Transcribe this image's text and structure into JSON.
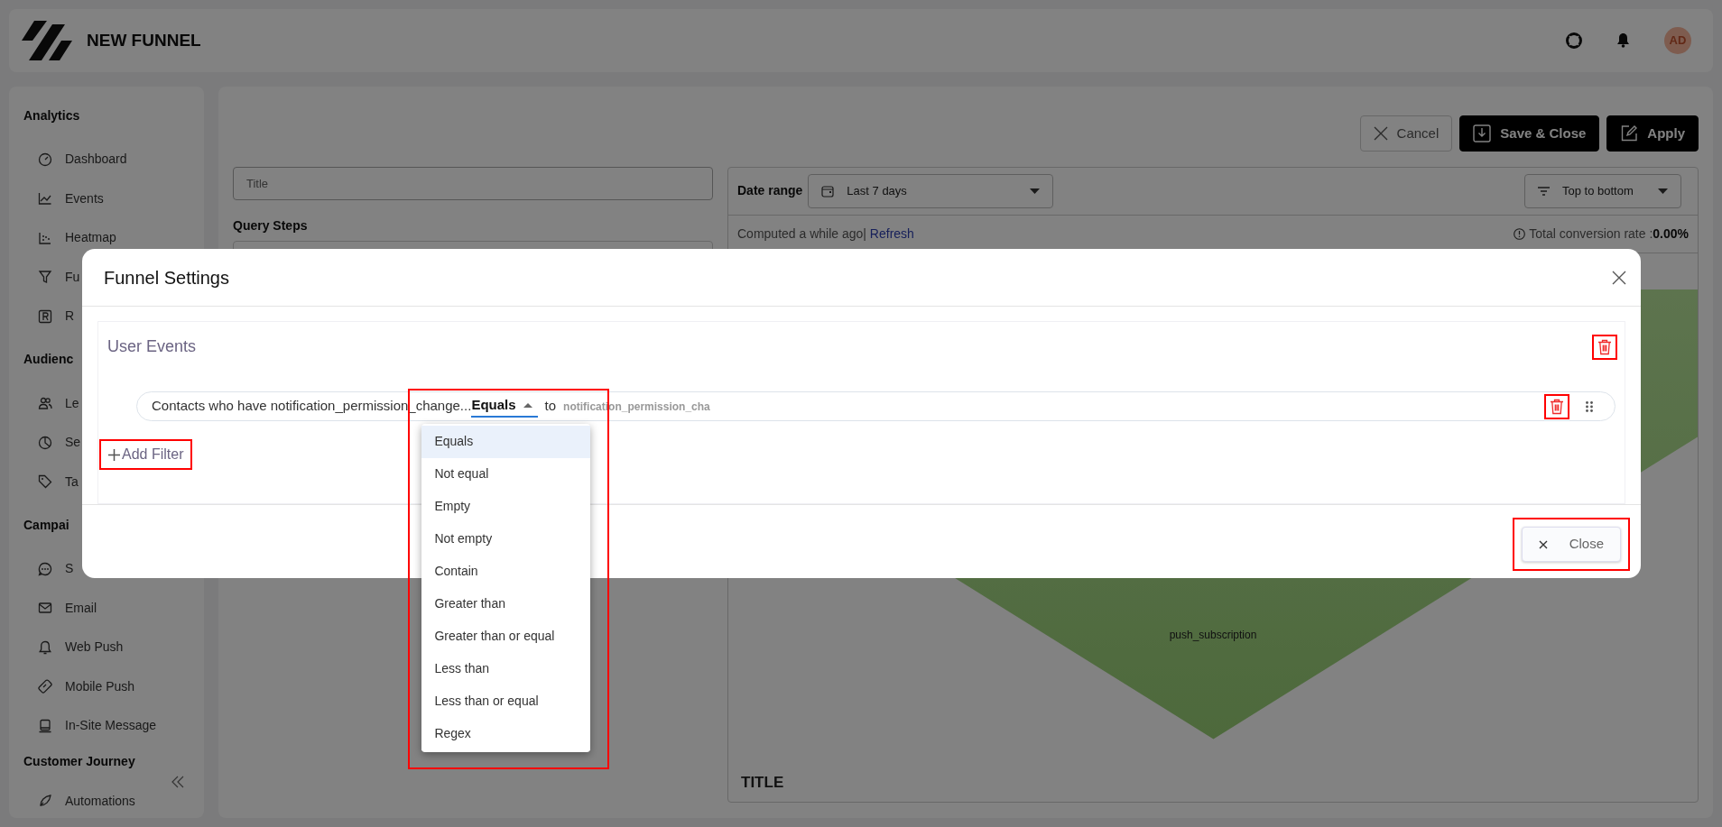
{
  "header": {
    "title": "NEW FUNNEL",
    "avatar": "AD"
  },
  "sidebar": {
    "sections": [
      {
        "title": "Analytics",
        "items": [
          {
            "label": "Dashboard"
          },
          {
            "label": "Events"
          },
          {
            "label": "Heatmap"
          },
          {
            "label": "Fu"
          },
          {
            "label": "R"
          }
        ]
      },
      {
        "title": "Audienc",
        "items": [
          {
            "label": "Le"
          },
          {
            "label": "Se"
          },
          {
            "label": "Ta"
          }
        ]
      },
      {
        "title": "Campai",
        "items": [
          {
            "label": "S"
          },
          {
            "label": "Email"
          },
          {
            "label": "Web Push"
          },
          {
            "label": "Mobile Push"
          },
          {
            "label": "In-Site Message"
          }
        ]
      },
      {
        "title": "Customer Journey",
        "items": [
          {
            "label": "Automations"
          }
        ]
      }
    ]
  },
  "toolbar": [
    {
      "label": "Cancel",
      "kind": "outline"
    },
    {
      "label": "Save & Close",
      "kind": "dark"
    },
    {
      "label": "Apply",
      "kind": "dark"
    }
  ],
  "title_field": {
    "placeholder": "Title"
  },
  "query_steps": {
    "label": "Query Steps"
  },
  "report": {
    "date_range": {
      "label": "Date range",
      "value": "Last 7 days"
    },
    "order": {
      "value": "Top to bottom"
    },
    "computed": "Computed a while ago|",
    "refresh": "Refresh",
    "conversion": {
      "label": "Total conversion rate :",
      "value": "0.00%"
    },
    "funnel_step": "push_subscription",
    "title": "TITLE"
  },
  "modal": {
    "title": "Funnel Settings",
    "section": {
      "title": "User Events",
      "delete_highlighted": true
    },
    "filter": {
      "text": "Contacts who have notification_permission_change...",
      "operator": "Equals",
      "operator_highlighted": true,
      "connector": "to",
      "value_placeholder": "notification_permission_cha",
      "delete_highlighted": true
    },
    "operator_options": [
      {
        "label": "Equals",
        "selected": true
      },
      {
        "label": "Not equal",
        "selected": false
      },
      {
        "label": "Empty",
        "selected": false
      },
      {
        "label": "Not empty",
        "selected": false
      },
      {
        "label": "Contain",
        "selected": false
      },
      {
        "label": "Greater than",
        "selected": false
      },
      {
        "label": "Greater than or equal",
        "selected": false
      },
      {
        "label": "Less than",
        "selected": false
      },
      {
        "label": "Less than or equal",
        "selected": false
      },
      {
        "label": "Regex",
        "selected": false
      }
    ],
    "add_filter": {
      "label": "Add Filter",
      "highlighted": true
    },
    "close_button": {
      "label": "Close",
      "highlighted": true
    }
  }
}
